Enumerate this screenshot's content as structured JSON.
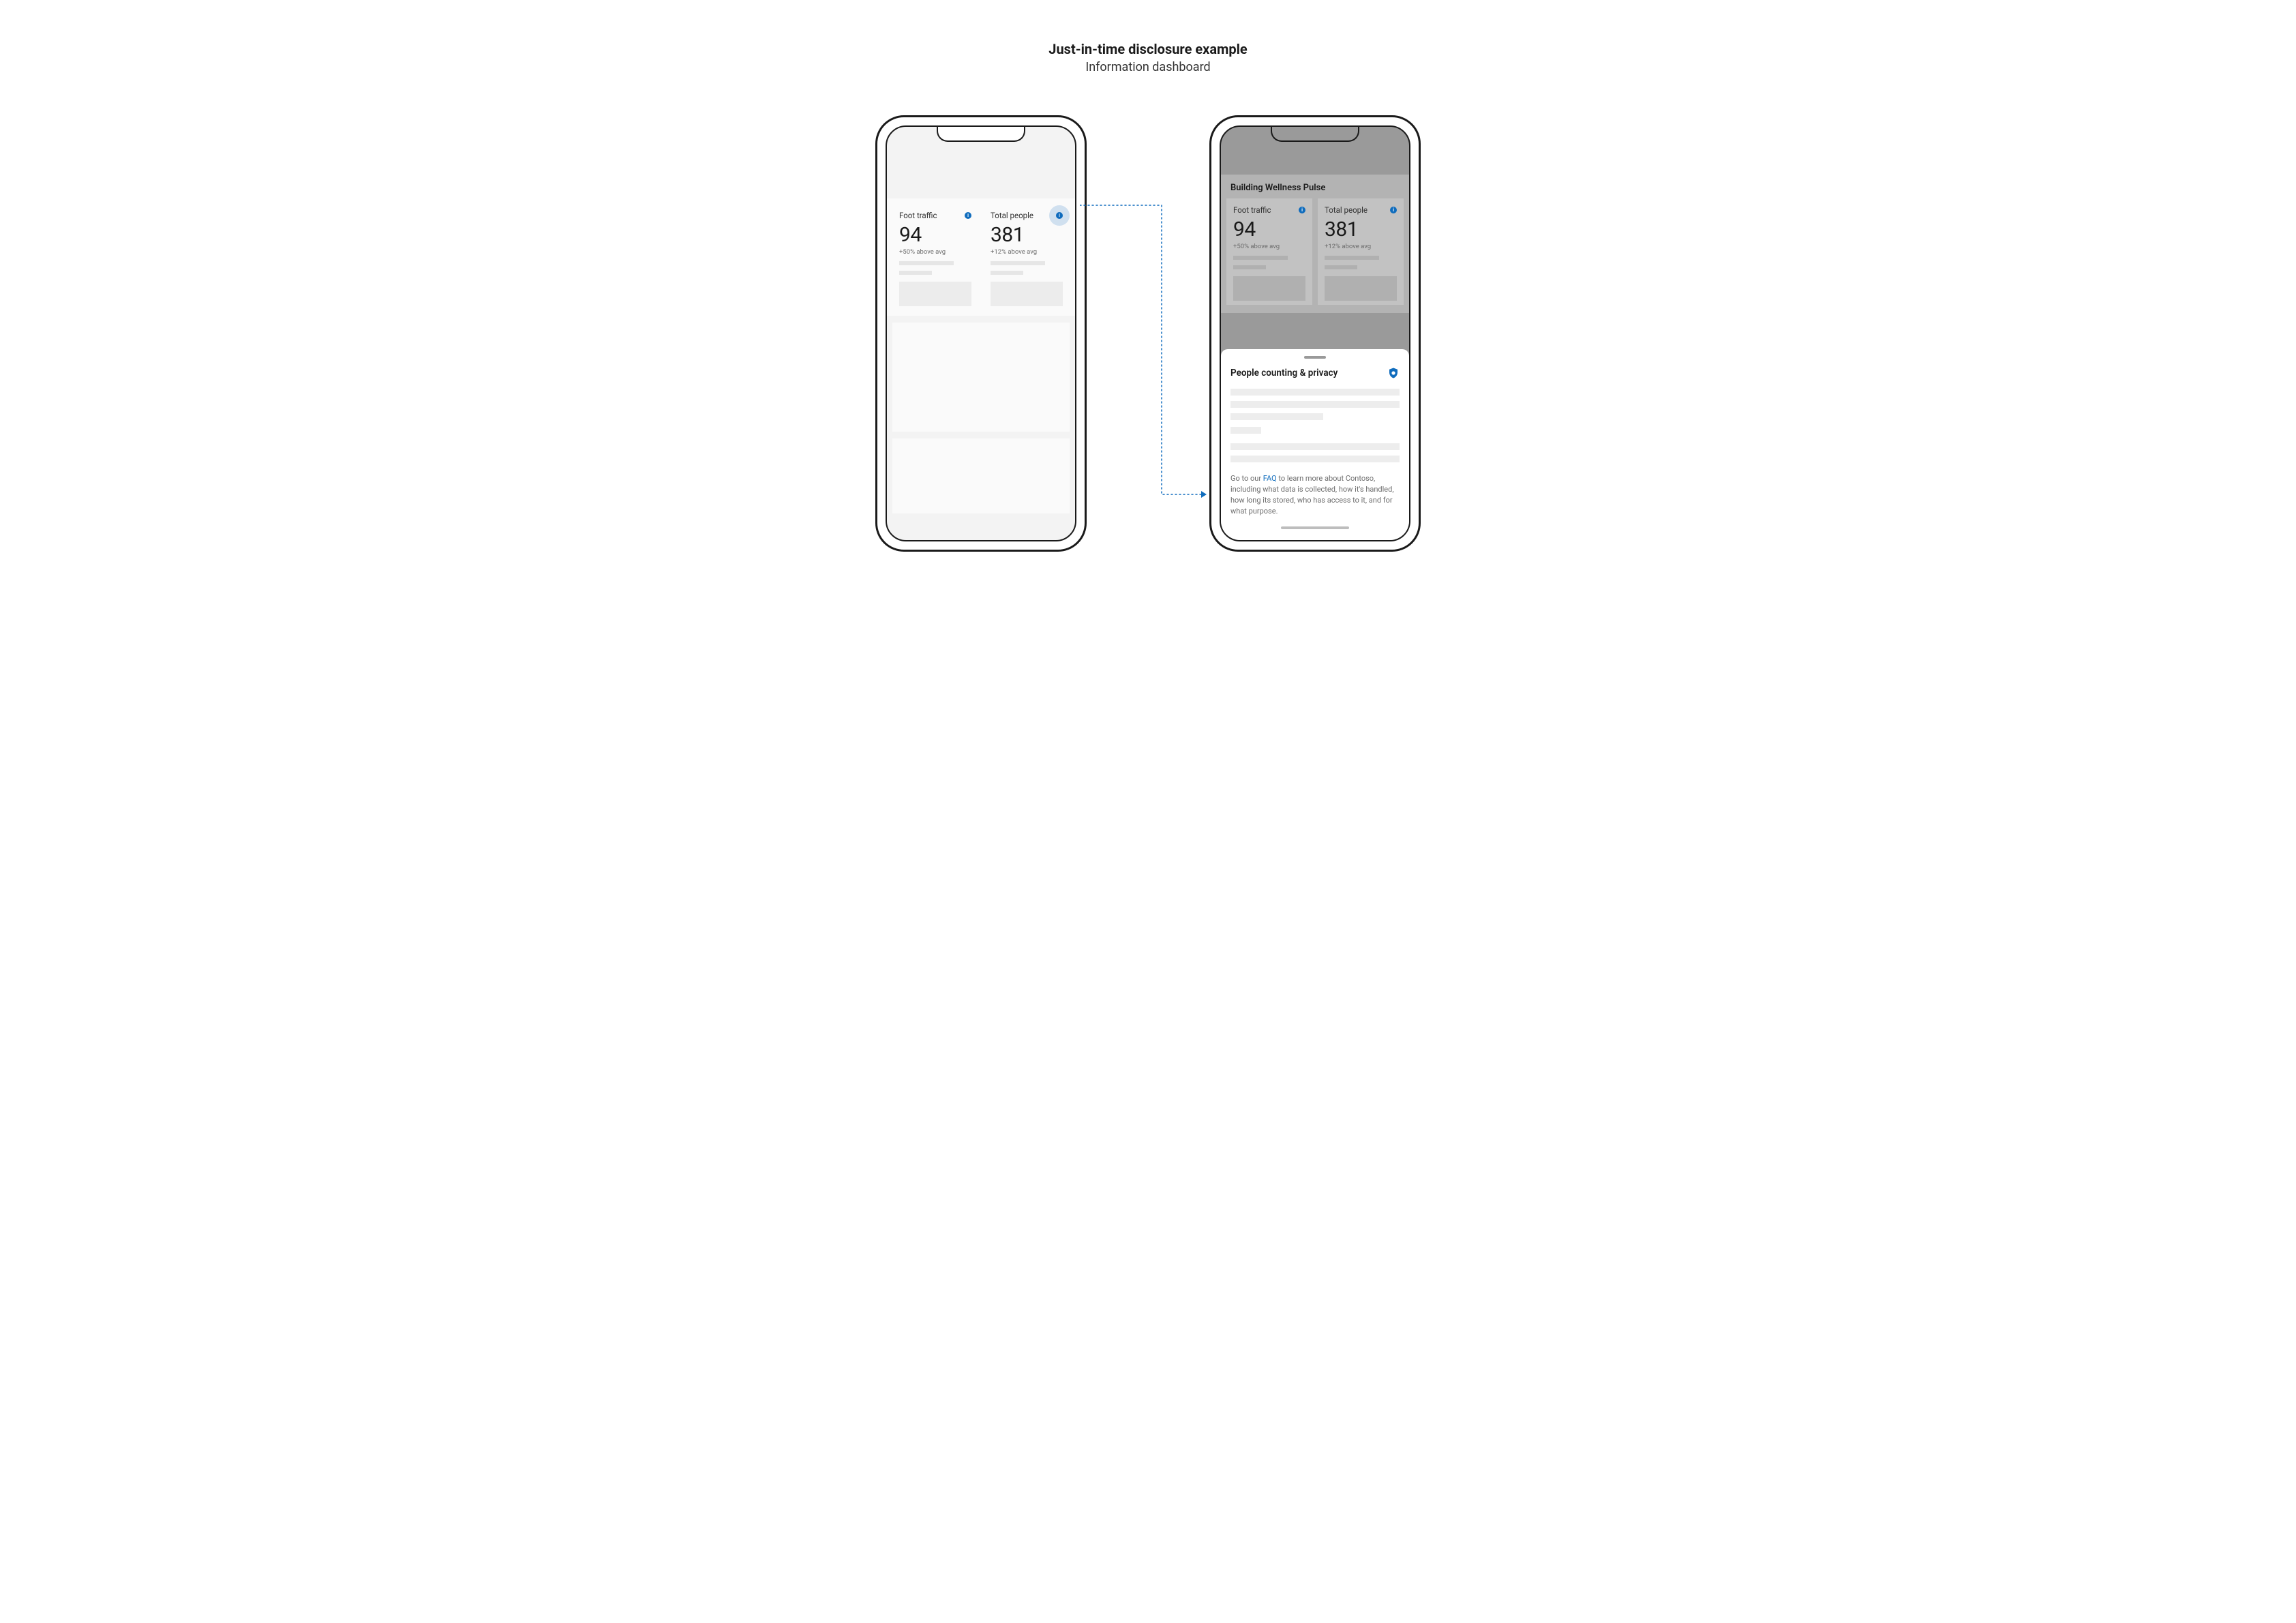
{
  "header": {
    "title": "Just-in-time disclosure example",
    "subtitle": "Information dashboard"
  },
  "left_phone": {
    "cards": [
      {
        "title": "Foot traffic",
        "value": "94",
        "delta": "+50% above avg"
      },
      {
        "title": "Total people",
        "value": "381",
        "delta": "+12% above avg"
      }
    ]
  },
  "right_phone": {
    "section_title": "Building Wellness Pulse",
    "cards": [
      {
        "title": "Foot traffic",
        "value": "94",
        "delta": "+50% above avg"
      },
      {
        "title": "Total people",
        "value": "381",
        "delta": "+12% above avg"
      }
    ],
    "sheet": {
      "title": "People counting & privacy",
      "footer_intro": "Go to our ",
      "faq_label": "FAQ",
      "footer_rest": " to learn more about Contoso, including what data is collected, how it's handled, how long its stored, who has access to it, and for what purpose."
    }
  },
  "colors": {
    "accent": "#0f6cbd"
  }
}
